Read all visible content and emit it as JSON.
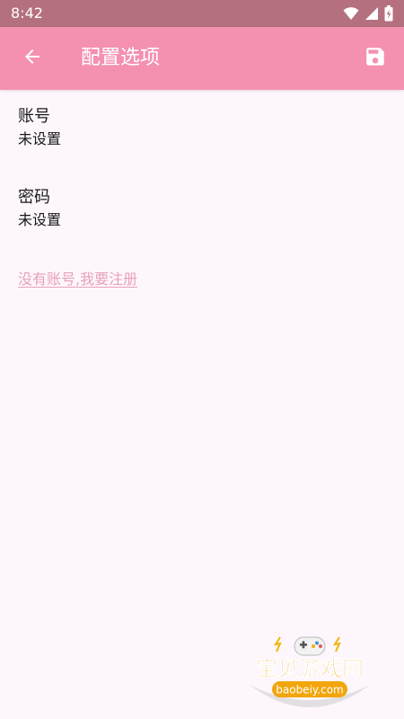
{
  "status_bar": {
    "time": "8:42",
    "icons": [
      "wifi-icon",
      "signal-icon",
      "battery-icon"
    ]
  },
  "app_bar": {
    "title": "配置选项",
    "back_icon": "arrow-back-icon",
    "save_icon": "save-icon",
    "color": "#f490b0"
  },
  "preferences": [
    {
      "title": "账号",
      "summary": "未设置"
    },
    {
      "title": "密码",
      "summary": "未设置"
    }
  ],
  "register_link": "没有账号,我要注册",
  "watermark": {
    "name": "宝贝游戏网",
    "domain": "baobeiy.com"
  },
  "colors": {
    "status_bar": "#b5707f",
    "app_bar": "#f490b0",
    "background": "#fdf6fd",
    "link": "#e8a0bb"
  }
}
